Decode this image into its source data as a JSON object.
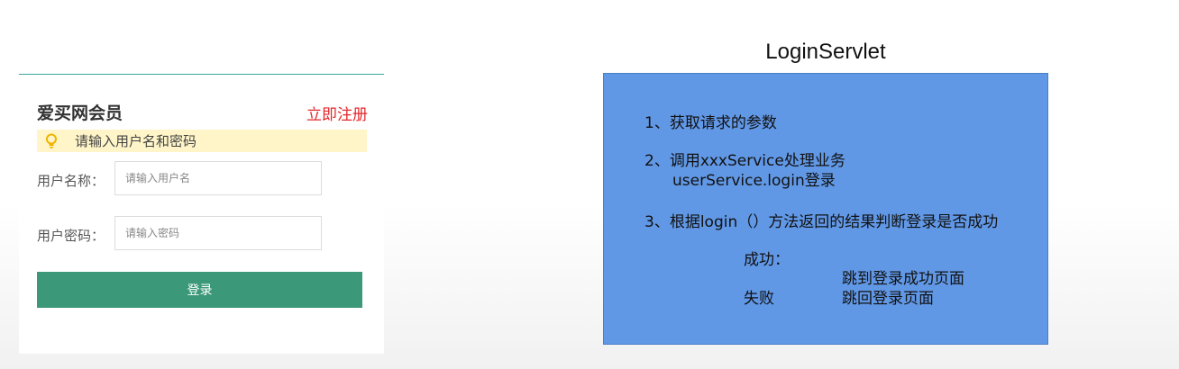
{
  "login_form": {
    "title": "爱买网会员",
    "register_link": "立即注册",
    "tip_text": "请输入用户名和密码",
    "username_label": "用户名称：",
    "username_placeholder": "请输入用户名",
    "password_label": "用户密码：",
    "password_placeholder": "请输入密码",
    "login_button": "登录"
  },
  "servlet": {
    "title": "LoginServlet",
    "step1": "1、获取请求的参数",
    "step2_line1": "2、调用xxxService处理业务",
    "step2_line2": "userService.login登录",
    "step3": "3、根据login（）方法返回的结果判断登录是否成功",
    "success_label": "成功：",
    "success_action": "跳到登录成功页面",
    "fail_label": "失败",
    "fail_action": "跳回登录页面"
  },
  "colors": {
    "tip_background": "#fff5c9",
    "register_link": "#e4262b",
    "login_button": "#3b9879",
    "servlet_box": "#6198e6"
  },
  "icons": [
    "lightbulb-icon"
  ]
}
